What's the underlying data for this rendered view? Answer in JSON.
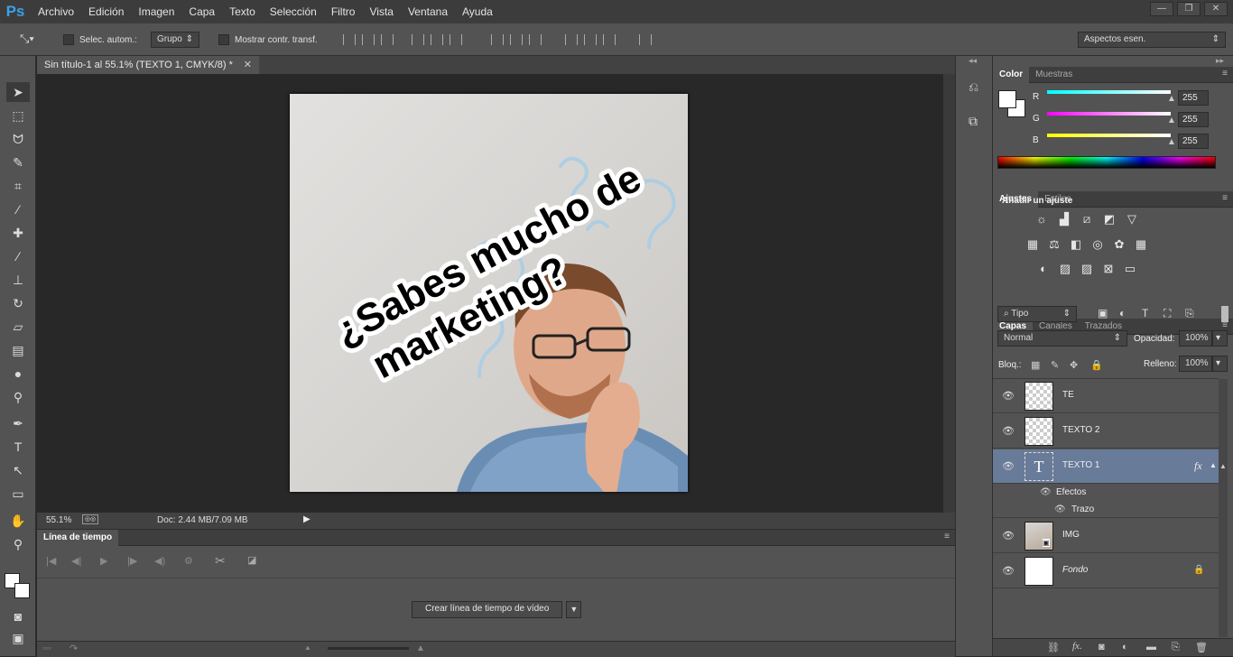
{
  "app": {
    "logo": "Ps"
  },
  "menu": [
    "Archivo",
    "Edición",
    "Imagen",
    "Capa",
    "Texto",
    "Selección",
    "Filtro",
    "Vista",
    "Ventana",
    "Ayuda"
  ],
  "options": {
    "auto_select_label": "Selec. autom.:",
    "auto_select_value": "Grupo",
    "show_transform_label": "Mostrar contr. transf.",
    "workspace": "Aspectos esen."
  },
  "document": {
    "tab_title": "Sin título-1 al 55.1% (TEXTO 1, CMYK/8) *",
    "headline_line1": "¿Sabes mucho de",
    "headline_line2": "marketing?",
    "zoom": "55.1%",
    "doc_size": "Doc: 2.44 MB/7.09 MB"
  },
  "timeline": {
    "title": "Línea de tiempo",
    "create_button": "Crear línea de tiempo de vídeo"
  },
  "color_panel": {
    "tabs": [
      "Color",
      "Muestras"
    ],
    "channels": [
      {
        "label": "R",
        "value": "255",
        "color": "#00ffff"
      },
      {
        "label": "G",
        "value": "255",
        "color": "#ff00ff"
      },
      {
        "label": "B",
        "value": "255",
        "color": "#ffff00"
      }
    ]
  },
  "adjustments_panel": {
    "tabs": [
      "Ajustes",
      "Estilos"
    ],
    "heading": "Añadir un ajuste"
  },
  "layers_panel": {
    "tabs": [
      "Capas",
      "Canales",
      "Trazados"
    ],
    "filter_kind": "Tipo",
    "blend_mode": "Normal",
    "opacity_label": "Opacidad:",
    "opacity": "100%",
    "lock_label": "Bloq.:",
    "fill_label": "Relleno:",
    "fill": "100%",
    "layers": [
      {
        "name": "TE"
      },
      {
        "name": "TEXTO 2"
      },
      {
        "name": "TEXTO 1"
      },
      {
        "name": "IMG"
      },
      {
        "name": "Fondo"
      }
    ],
    "effects_label": "Efectos",
    "stroke_label": "Trazo",
    "fx_label": "fx"
  }
}
